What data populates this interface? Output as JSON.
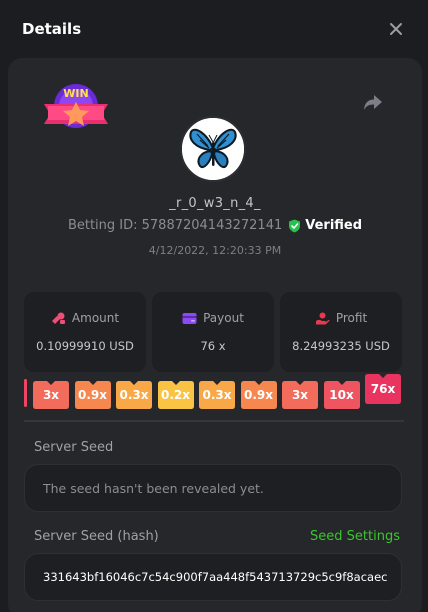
{
  "header": {
    "title": "Details"
  },
  "user": {
    "badge_text": "WIN",
    "username": "_r_0_w3_n_4_",
    "betting_id": "Betting ID: 57887204143272141",
    "verified_label": "Verified",
    "timestamp": "4/12/2022, 12:20:33 PM"
  },
  "stats": [
    {
      "label": "Amount",
      "value": "0.10999910 USD",
      "icon": "coins-icon"
    },
    {
      "label": "Payout",
      "value": "76 x",
      "icon": "wallet-icon"
    },
    {
      "label": "Profit",
      "value": "8.24993235 USD",
      "icon": "profit-icon"
    }
  ],
  "multipliers": [
    {
      "label": "3x",
      "color": "#f26b5b",
      "level": 1
    },
    {
      "label": "0.9x",
      "color": "#f5874f",
      "level": 1
    },
    {
      "label": "0.3x",
      "color": "#f9a847",
      "level": 1
    },
    {
      "label": "0.2x",
      "color": "#fbc344",
      "level": 1
    },
    {
      "label": "0.3x",
      "color": "#f9a847",
      "level": 1
    },
    {
      "label": "0.9x",
      "color": "#f5874f",
      "level": 1
    },
    {
      "label": "3x",
      "color": "#f26b5b",
      "level": 1
    },
    {
      "label": "10x",
      "color": "#ef5560",
      "level": 1
    },
    {
      "label": "76x",
      "color": "#e8345f",
      "level": 2
    }
  ],
  "server_seed": {
    "label": "Server Seed",
    "value": "The seed hasn't been revealed yet."
  },
  "server_seed_hash": {
    "label": "Server Seed (hash)",
    "settings_link": "Seed Settings",
    "value": "331643bf16046c7c54c900f7aa448f543713729c5c9f8acaec"
  },
  "colors": {
    "accent_green": "#3cc62e",
    "panel": "#25272b",
    "field": "#1e1f23"
  }
}
